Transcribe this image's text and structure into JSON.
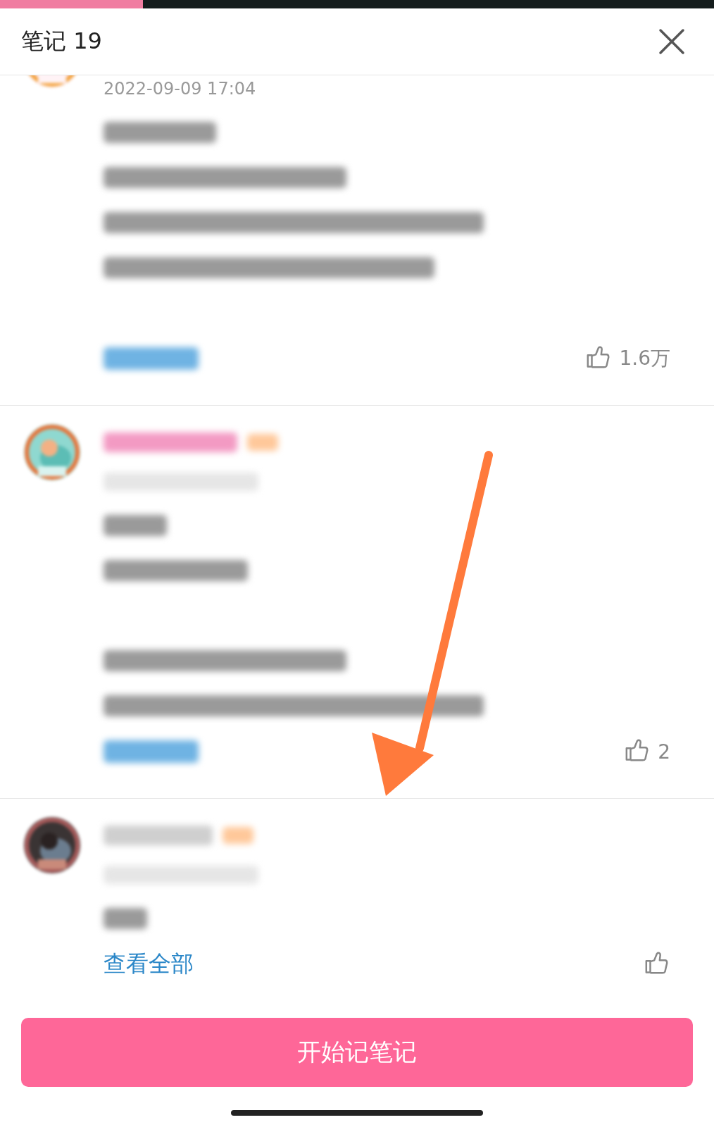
{
  "progress": {
    "level": 0.2
  },
  "header": {
    "title": "笔记 19"
  },
  "comments": [
    {
      "date": "2022-09-09 17:04",
      "likes": "1.6万"
    },
    {
      "likes": "2"
    },
    {
      "view_all": "查看全部"
    }
  ],
  "button": "开始记笔记"
}
